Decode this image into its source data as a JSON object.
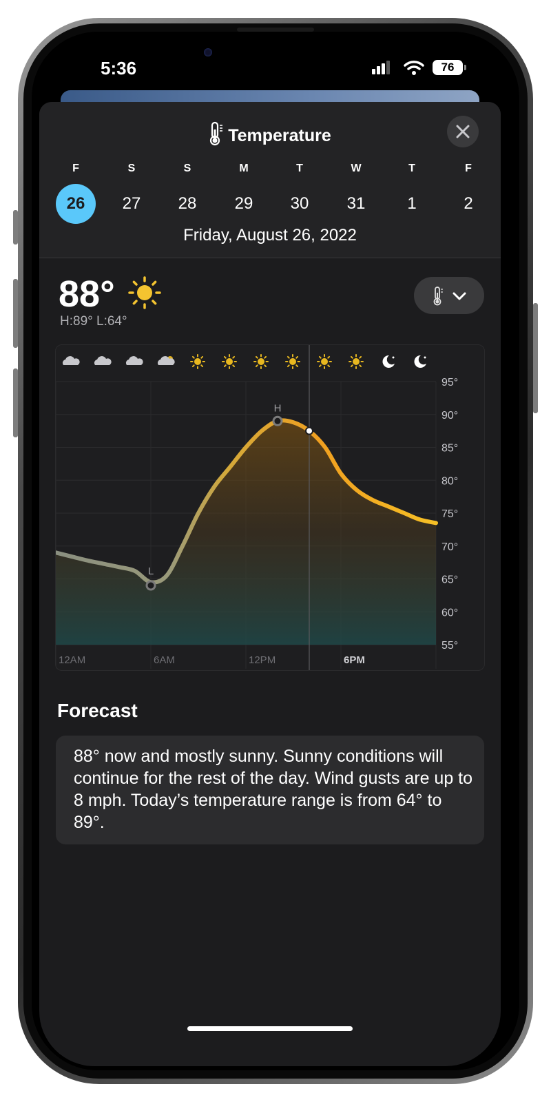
{
  "status_bar": {
    "time": "5:36",
    "battery": "76"
  },
  "header": {
    "title": "Temperature",
    "thermometer_icon": "thermometer-icon",
    "close_icon": "close-icon"
  },
  "days": [
    {
      "dow": "F",
      "date": "26",
      "selected": true
    },
    {
      "dow": "S",
      "date": "27"
    },
    {
      "dow": "S",
      "date": "28"
    },
    {
      "dow": "M",
      "date": "29"
    },
    {
      "dow": "T",
      "date": "30"
    },
    {
      "dow": "W",
      "date": "31"
    },
    {
      "dow": "T",
      "date": "1"
    },
    {
      "dow": "F",
      "date": "2"
    }
  ],
  "selected_date_label": "Friday, August 26, 2022",
  "current": {
    "temp": "88°",
    "condition_icon": "sun-icon",
    "high_low": "H:89° L:64°"
  },
  "colors": {
    "accent": "#5ac8fa",
    "sun": "#f4c430",
    "sheet": "#1c1c1e"
  },
  "chart_data": {
    "type": "area",
    "x_tick_labels": [
      "12AM",
      "6AM",
      "12PM",
      "6PM"
    ],
    "y_tick_labels": [
      "95°",
      "90°",
      "85°",
      "80°",
      "75°",
      "70°",
      "65°",
      "60°",
      "55°"
    ],
    "ylim": [
      55,
      95
    ],
    "xlim": [
      0,
      24
    ],
    "x": [
      0,
      1,
      2,
      3,
      4,
      5,
      6,
      7,
      8,
      9,
      10,
      11,
      12,
      13,
      14,
      15,
      16,
      17,
      18,
      19,
      20,
      21,
      22,
      23,
      24
    ],
    "y": [
      69,
      68.4,
      67.8,
      67.3,
      66.8,
      66.2,
      64.5,
      65.5,
      70,
      75,
      79,
      82,
      85,
      87.5,
      89,
      88.8,
      87.5,
      85,
      81,
      78.5,
      77,
      76,
      75,
      74,
      73.5
    ],
    "marker_low": {
      "x": 6,
      "y": 64,
      "label": "L"
    },
    "marker_high": {
      "x": 14,
      "y": 89,
      "label": "H"
    },
    "current_x": 16,
    "current_label": "6PM",
    "hourly_icons": [
      "cloud-icon",
      "cloud-icon",
      "cloud-icon",
      "partly-sunny-icon",
      "sun-icon",
      "sun-icon",
      "sun-icon",
      "sun-icon",
      "sun-icon",
      "sun-icon",
      "moon-icon",
      "moon-icon"
    ]
  },
  "forecast": {
    "title": "Forecast",
    "text": "88° now and mostly sunny. Sunny conditions will continue for the rest of the day. Wind gusts are up to 8 mph. Today’s temperature range is from 64° to 89°."
  }
}
